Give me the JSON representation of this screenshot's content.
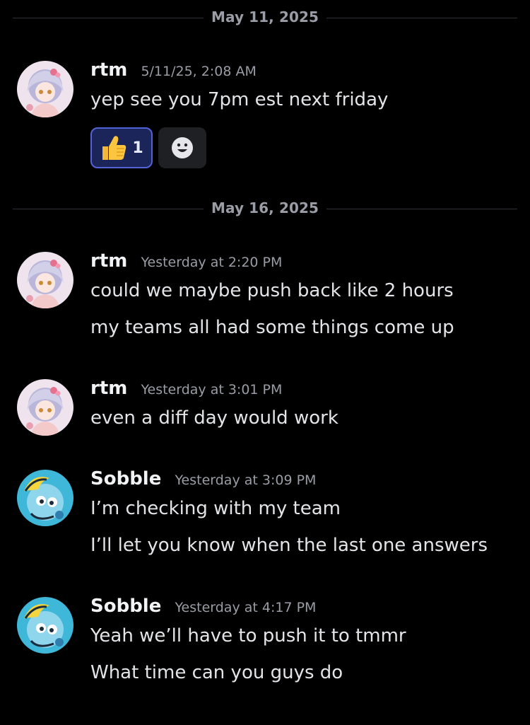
{
  "dividers": [
    {
      "date": "May 11, 2025"
    },
    {
      "date": "May 16, 2025"
    }
  ],
  "messages": [
    {
      "author": "rtm",
      "timestamp": "5/11/25, 2:08 AM",
      "lines": [
        "yep see you 7pm est next friday"
      ],
      "reactions": [
        {
          "emoji": "thumbs-up",
          "count": "1"
        }
      ]
    },
    {
      "author": "rtm",
      "timestamp": "Yesterday at 2:20 PM",
      "lines": [
        "could we maybe push back like 2 hours",
        "my teams all had some things come up"
      ]
    },
    {
      "author": "rtm",
      "timestamp": "Yesterday at 3:01 PM",
      "lines": [
        "even a diff day would work"
      ]
    },
    {
      "author": "Sobble",
      "timestamp": "Yesterday at 3:09 PM",
      "lines": [
        "I’m checking with my team",
        "I’ll let you know when the last one answers"
      ]
    },
    {
      "author": "Sobble",
      "timestamp": "Yesterday at 4:17 PM",
      "lines": [
        "Yeah we’ll have to push it to tmmr",
        "What time can you guys do"
      ]
    }
  ],
  "colors": {
    "background": "#000000",
    "reaction_active_bg": "#1c2559",
    "reaction_active_border": "#5462d8",
    "muted_text": "#9a9ca6"
  },
  "icons": {
    "reaction": "thumbs-up-emoji",
    "add_reaction": "smiley-icon"
  }
}
